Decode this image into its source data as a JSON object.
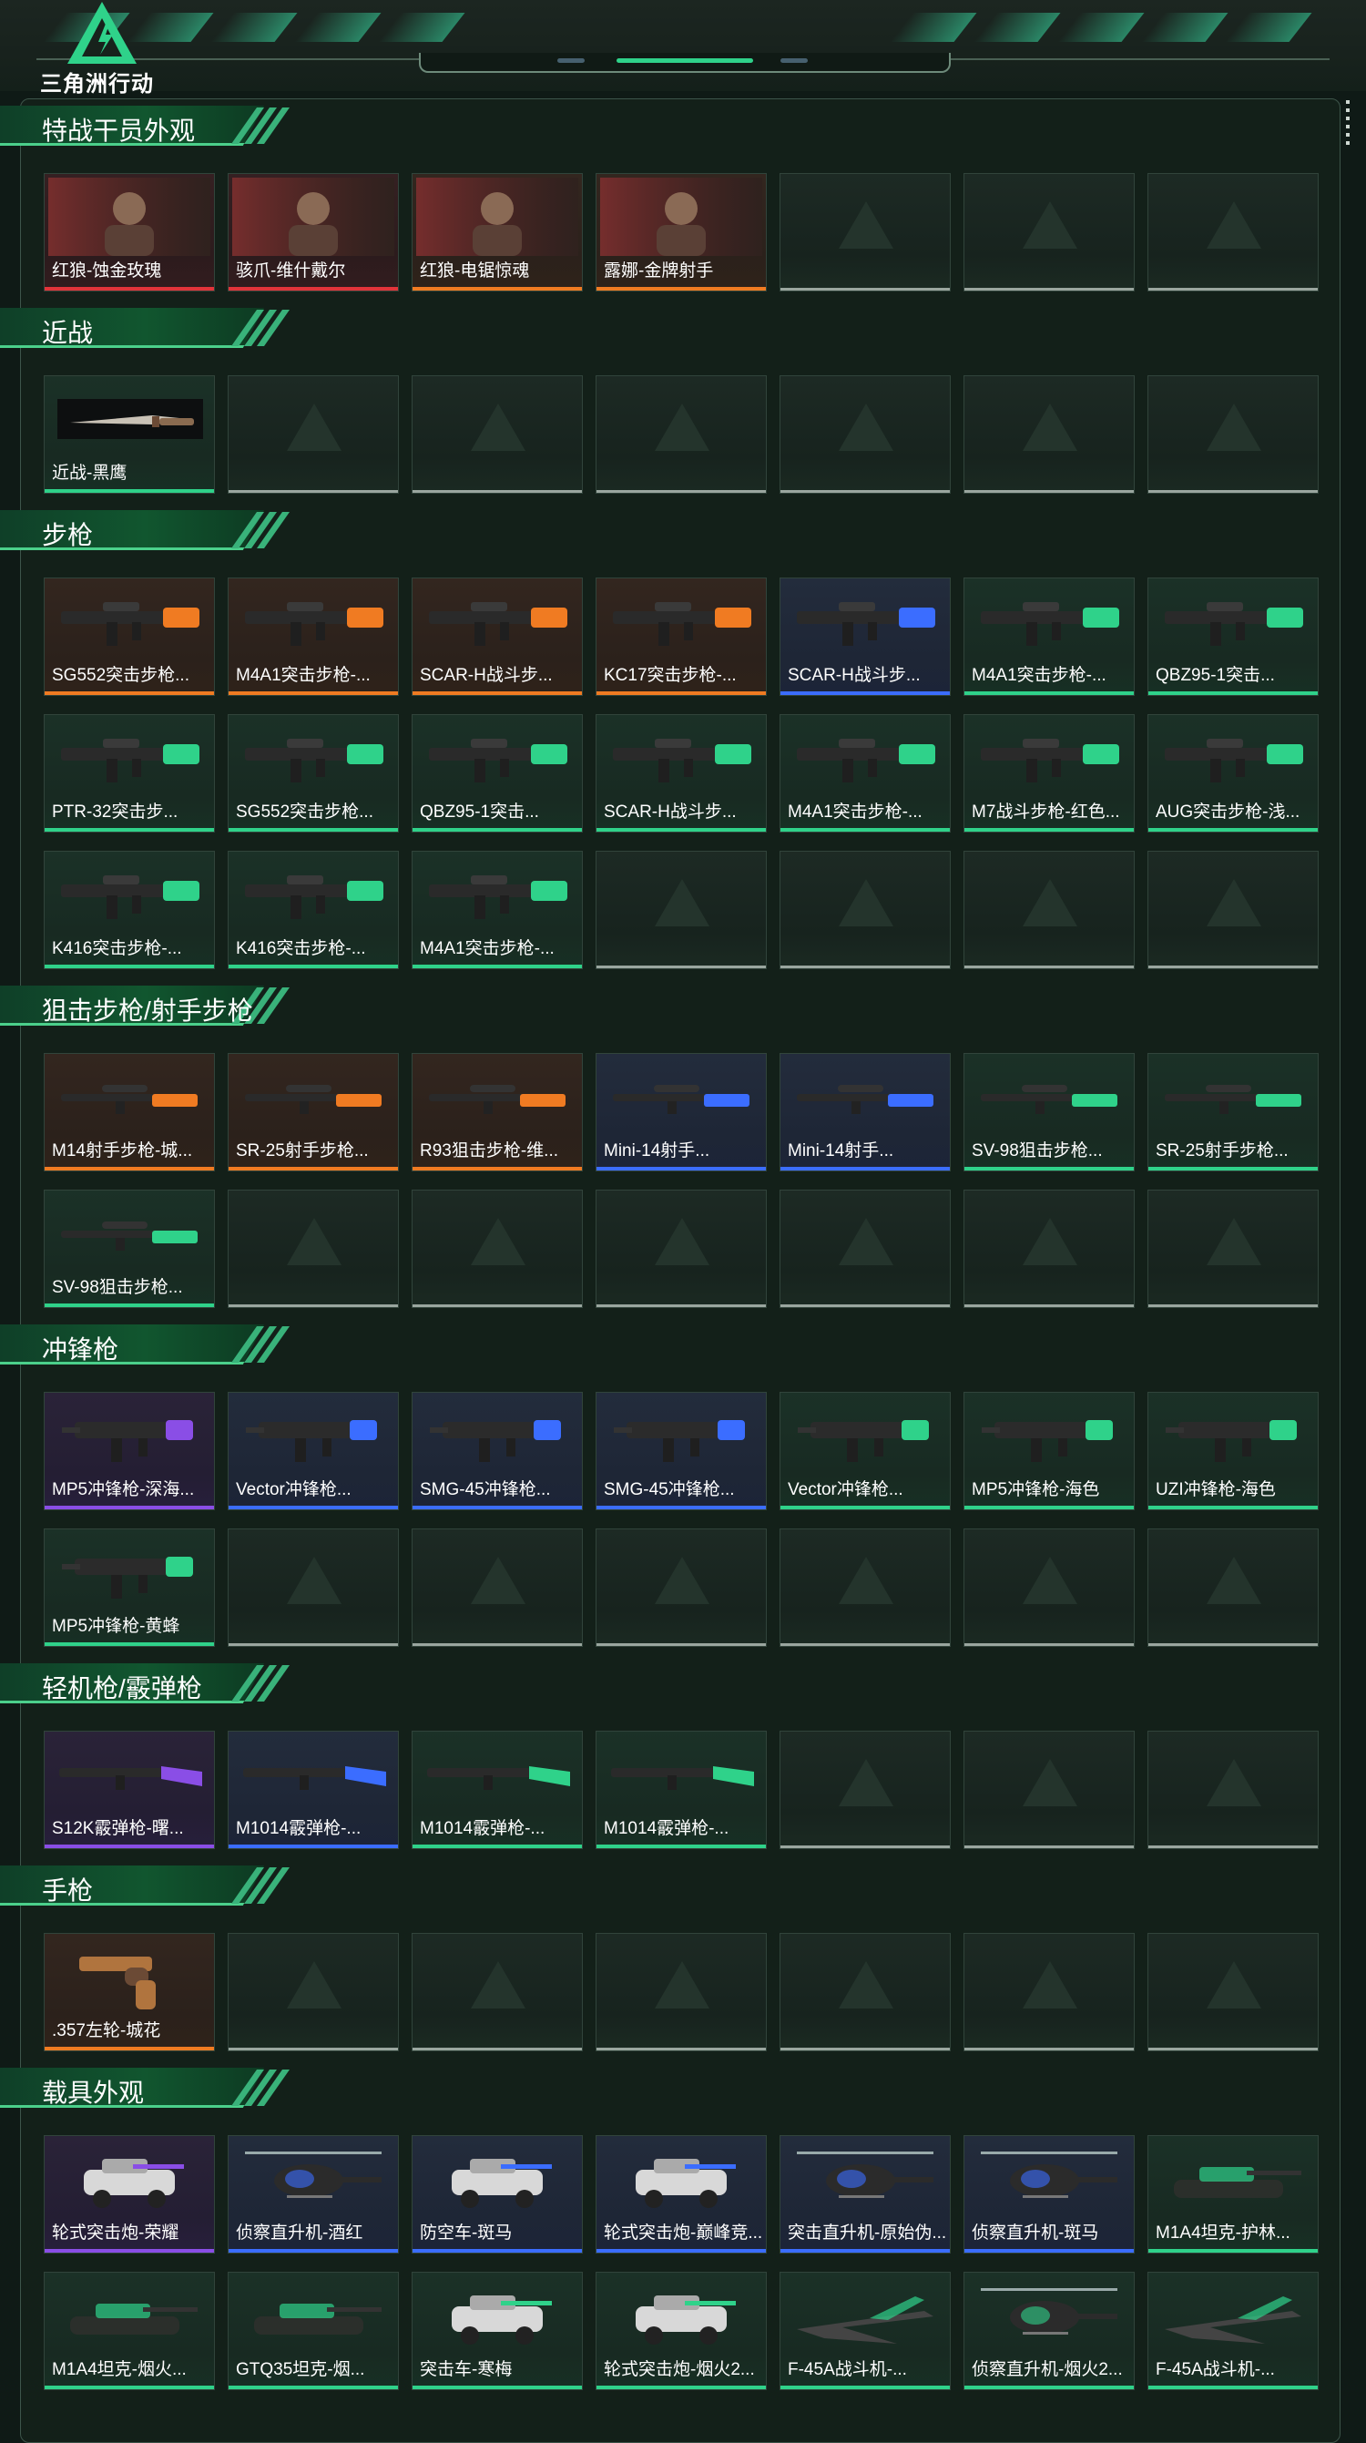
{
  "brand": {
    "title": "三角洲行动"
  },
  "colors": {
    "accent": "#2fd28a",
    "rarity": {
      "green": "#2fd28a",
      "blue": "#3b6dff",
      "purple": "#8a4ee6",
      "orange": "#f07b22",
      "red": "#e2343a"
    }
  },
  "sections": [
    {
      "title": "特战干员外观",
      "items": [
        {
          "label": "红狼-蚀金玫瑰",
          "rarity": "red",
          "icon": "operator-portrait"
        },
        {
          "label": "骇爪-维什戴尔",
          "rarity": "red",
          "icon": "operator-portrait"
        },
        {
          "label": "红狼-电锯惊魂",
          "rarity": "orange",
          "icon": "operator-portrait"
        },
        {
          "label": "露娜-金牌射手",
          "rarity": "orange",
          "icon": "operator-portrait"
        }
      ],
      "empty": 3
    },
    {
      "title": "近战",
      "items": [
        {
          "label": "近战-黑鹰",
          "rarity": "green",
          "icon": "knife-icon"
        }
      ],
      "empty": 6
    },
    {
      "title": "步枪",
      "items": [
        {
          "label": "SG552突击步枪...",
          "rarity": "orange",
          "icon": "rifle-icon"
        },
        {
          "label": "M4A1突击步枪-...",
          "rarity": "orange",
          "icon": "rifle-icon"
        },
        {
          "label": "SCAR-H战斗步...",
          "rarity": "orange",
          "icon": "rifle-icon"
        },
        {
          "label": "KC17突击步枪-...",
          "rarity": "orange",
          "icon": "rifle-icon"
        },
        {
          "label": "SCAR-H战斗步...",
          "rarity": "blue",
          "icon": "rifle-icon"
        },
        {
          "label": "M4A1突击步枪-...",
          "rarity": "green",
          "icon": "rifle-icon"
        },
        {
          "label": "QBZ95-1突击...",
          "rarity": "green",
          "icon": "rifle-icon"
        },
        {
          "label": "PTR-32突击步...",
          "rarity": "green",
          "icon": "rifle-icon"
        },
        {
          "label": "SG552突击步枪...",
          "rarity": "green",
          "icon": "rifle-icon"
        },
        {
          "label": "QBZ95-1突击...",
          "rarity": "green",
          "icon": "rifle-icon"
        },
        {
          "label": "SCAR-H战斗步...",
          "rarity": "green",
          "icon": "rifle-icon"
        },
        {
          "label": "M4A1突击步枪-...",
          "rarity": "green",
          "icon": "rifle-icon"
        },
        {
          "label": "M7战斗步枪-红色...",
          "rarity": "green",
          "icon": "rifle-icon"
        },
        {
          "label": "AUG突击步枪-浅...",
          "rarity": "green",
          "icon": "rifle-icon"
        },
        {
          "label": "K416突击步枪-...",
          "rarity": "green",
          "icon": "rifle-icon"
        },
        {
          "label": "K416突击步枪-...",
          "rarity": "green",
          "icon": "rifle-icon"
        },
        {
          "label": "M4A1突击步枪-...",
          "rarity": "green",
          "icon": "rifle-icon"
        }
      ],
      "empty": 4
    },
    {
      "title": "狙击步枪/射手步枪",
      "items": [
        {
          "label": "M14射手步枪-城...",
          "rarity": "orange",
          "icon": "sniper-icon"
        },
        {
          "label": "SR-25射手步枪...",
          "rarity": "orange",
          "icon": "sniper-icon"
        },
        {
          "label": "R93狙击步枪-维...",
          "rarity": "orange",
          "icon": "sniper-icon"
        },
        {
          "label": "Mini-14射手...",
          "rarity": "blue",
          "icon": "sniper-icon"
        },
        {
          "label": "Mini-14射手...",
          "rarity": "blue",
          "icon": "sniper-icon"
        },
        {
          "label": "SV-98狙击步枪...",
          "rarity": "green",
          "icon": "sniper-icon"
        },
        {
          "label": "SR-25射手步枪...",
          "rarity": "green",
          "icon": "sniper-icon"
        },
        {
          "label": "SV-98狙击步枪...",
          "rarity": "green",
          "icon": "sniper-icon"
        }
      ],
      "empty": 6
    },
    {
      "title": "冲锋枪",
      "items": [
        {
          "label": "MP5冲锋枪-深海...",
          "rarity": "purple",
          "icon": "smg-icon"
        },
        {
          "label": "Vector冲锋枪...",
          "rarity": "blue",
          "icon": "smg-icon"
        },
        {
          "label": "SMG-45冲锋枪...",
          "rarity": "blue",
          "icon": "smg-icon"
        },
        {
          "label": "SMG-45冲锋枪...",
          "rarity": "blue",
          "icon": "smg-icon"
        },
        {
          "label": "Vector冲锋枪...",
          "rarity": "green",
          "icon": "smg-icon"
        },
        {
          "label": "MP5冲锋枪-海色",
          "rarity": "green",
          "icon": "smg-icon"
        },
        {
          "label": "UZI冲锋枪-海色",
          "rarity": "green",
          "icon": "smg-icon"
        },
        {
          "label": "MP5冲锋枪-黄蜂",
          "rarity": "green",
          "icon": "smg-icon"
        }
      ],
      "empty": 6
    },
    {
      "title": "轻机枪/霰弹枪",
      "items": [
        {
          "label": "S12K霰弹枪-曙...",
          "rarity": "purple",
          "icon": "shotgun-icon"
        },
        {
          "label": "M1014霰弹枪-...",
          "rarity": "blue",
          "icon": "shotgun-icon"
        },
        {
          "label": "M1014霰弹枪-...",
          "rarity": "green",
          "icon": "shotgun-icon"
        },
        {
          "label": "M1014霰弹枪-...",
          "rarity": "green",
          "icon": "shotgun-icon"
        }
      ],
      "empty": 3
    },
    {
      "title": "手枪",
      "items": [
        {
          "label": ".357左轮-城花",
          "rarity": "orange",
          "icon": "pistol-icon"
        }
      ],
      "empty": 6
    },
    {
      "title": "载具外观",
      "items": [
        {
          "label": "轮式突击炮-荣耀",
          "rarity": "purple",
          "icon": "vehicle-icon"
        },
        {
          "label": "侦察直升机-酒红",
          "rarity": "blue",
          "icon": "helicopter-icon"
        },
        {
          "label": "防空车-斑马",
          "rarity": "blue",
          "icon": "vehicle-icon"
        },
        {
          "label": "轮式突击炮-巅峰竞...",
          "rarity": "blue",
          "icon": "vehicle-icon"
        },
        {
          "label": "突击直升机-原始伪...",
          "rarity": "blue",
          "icon": "helicopter-icon"
        },
        {
          "label": "侦察直升机-斑马",
          "rarity": "blue",
          "icon": "helicopter-icon"
        },
        {
          "label": "M1A4坦克-护林...",
          "rarity": "green",
          "icon": "tank-icon"
        },
        {
          "label": "M1A4坦克-烟火...",
          "rarity": "green",
          "icon": "tank-icon"
        },
        {
          "label": "GTQ35坦克-烟...",
          "rarity": "green",
          "icon": "tank-icon"
        },
        {
          "label": "突击车-寒梅",
          "rarity": "green",
          "icon": "vehicle-icon"
        },
        {
          "label": "轮式突击炮-烟火2...",
          "rarity": "green",
          "icon": "vehicle-icon"
        },
        {
          "label": "F-45A战斗机-...",
          "rarity": "green",
          "icon": "jet-icon"
        },
        {
          "label": "侦察直升机-烟火2...",
          "rarity": "green",
          "icon": "helicopter-icon"
        },
        {
          "label": "F-45A战斗机-...",
          "rarity": "green",
          "icon": "jet-icon"
        }
      ],
      "empty": 0
    }
  ]
}
